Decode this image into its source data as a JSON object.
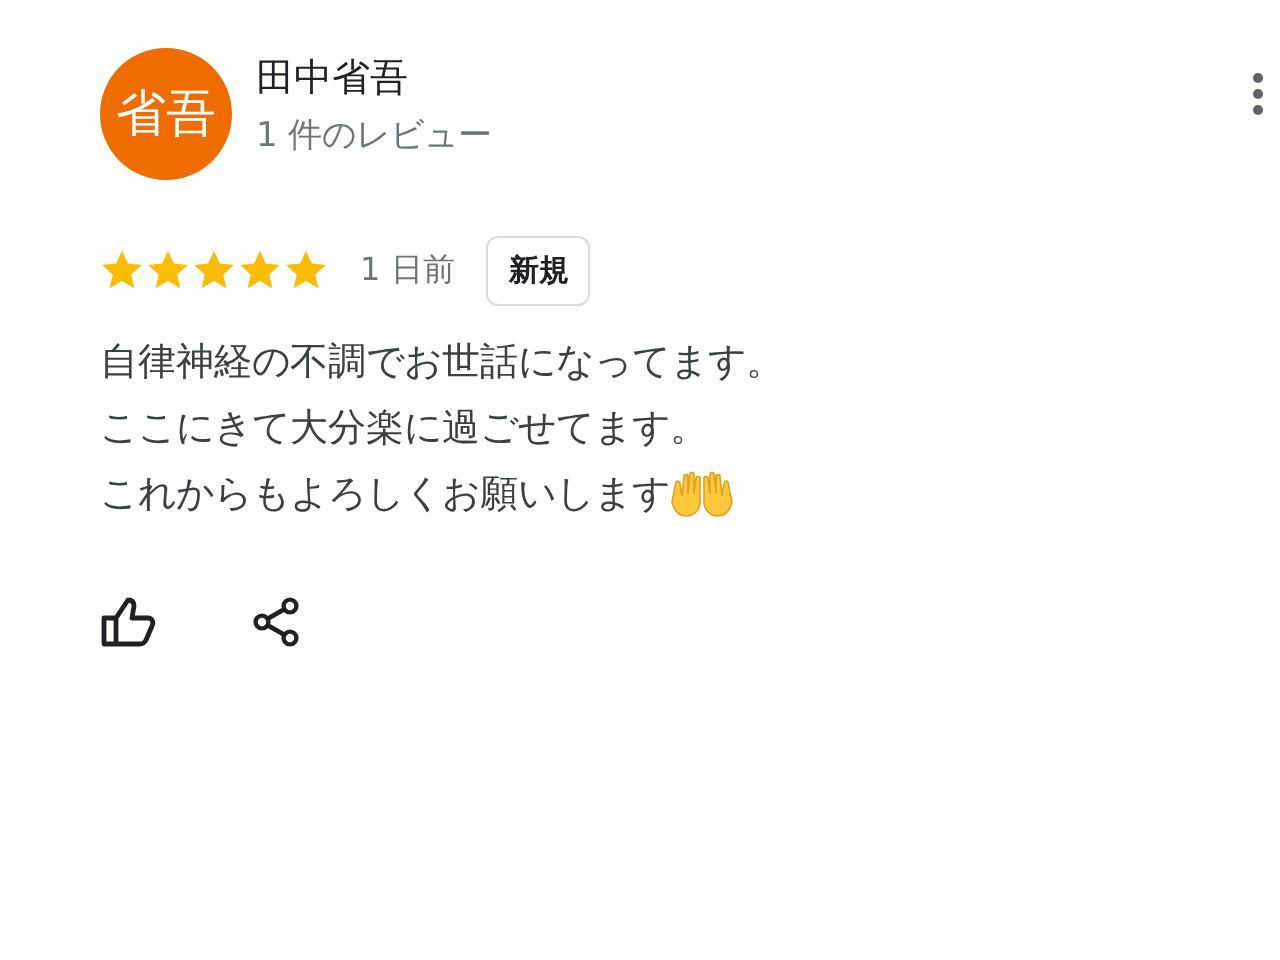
{
  "reviewer": {
    "avatar_text": "省吾",
    "name": "田中省吾",
    "review_count": "1 件のレビュー"
  },
  "review": {
    "stars": 5,
    "date": "1 日前",
    "badge": "新規",
    "lines": [
      "自律神経の不調でお世話になってます。",
      "ここにきて大分楽に過ごせてます。",
      "これからもよろしくお願いします"
    ]
  }
}
